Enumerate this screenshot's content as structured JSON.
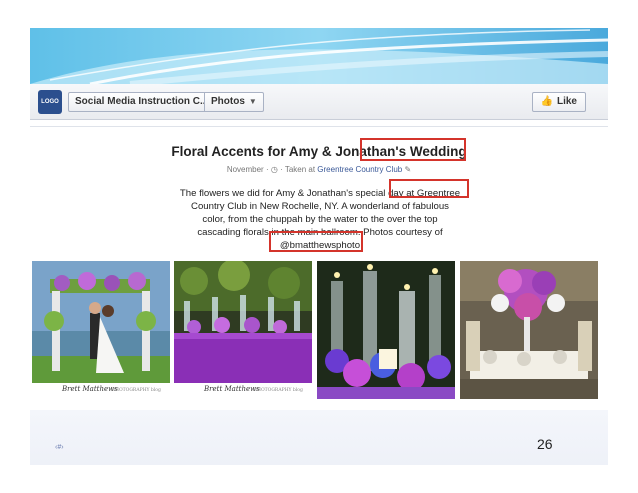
{
  "header": {
    "logo_label": "LOGO",
    "page_name": "Social Media Instruction C...",
    "section": "Photos",
    "like_label": "Like"
  },
  "album": {
    "title": "Floral Accents for Amy & Jonathan's Wedding",
    "date": "November",
    "taken_at_prefix": "Taken at",
    "location": "Greentree Country Club",
    "description_lines": [
      "The flowers we did for Amy & Jonathan's special day at Greentree",
      "Country Club in New Rochelle, NY. A wonderland of fabulous",
      "color, from the chuppah by the water to the over the top",
      "cascading florals in the main ballroom. Photos courtesy of",
      "@bmatthewsphoto"
    ]
  },
  "photos": [
    {
      "signature": "Brett Matthews",
      "signature_sub": "PHOTOGRAPHY blog"
    },
    {
      "signature": "Brett Matthews",
      "signature_sub": "PHOTOGRAPHY blog"
    },
    {
      "signature": ""
    },
    {
      "signature": ""
    }
  ],
  "slide": {
    "hash": "‹#›",
    "number": "26"
  },
  "colors": {
    "facebook_blue": "#3b5998",
    "highlight_red": "#d4342b"
  }
}
